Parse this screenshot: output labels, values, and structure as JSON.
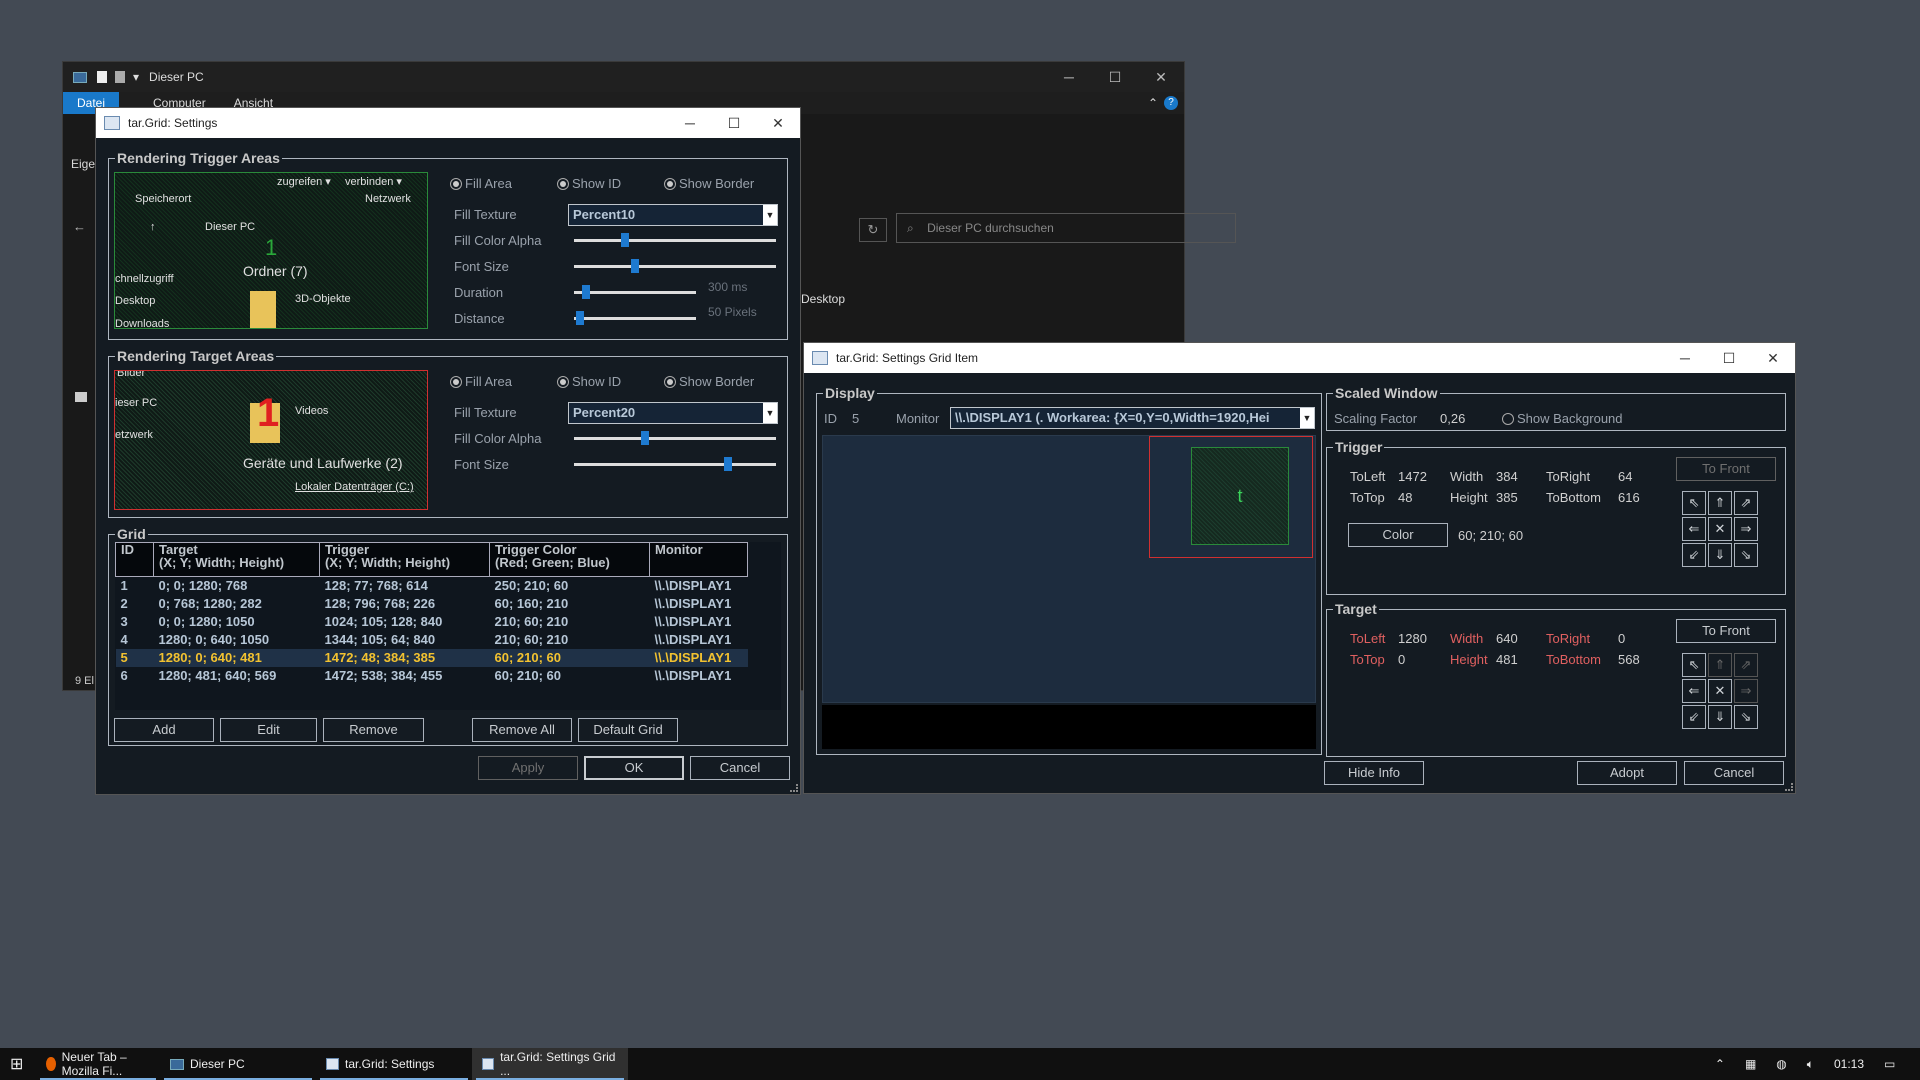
{
  "explorer": {
    "title": "Dieser PC",
    "ribbon_tabs": [
      "Datei",
      "Computer",
      "Ansicht"
    ],
    "search_placeholder": "Dieser PC durchsuchen",
    "side_text": "Eiger",
    "status": "9 El",
    "desktop_label": "Desktop",
    "path_hint": "n"
  },
  "settings": {
    "title": "tar.Grid: Settings",
    "trigger_group": "Rendering Trigger Areas",
    "target_group": "Rendering Target Areas",
    "fill_area": "Fill Area",
    "show_id": "Show ID",
    "show_border": "Show Border",
    "fill_texture_label": "Fill Texture",
    "trigger_texture": "Percent10",
    "target_texture": "Percent20",
    "fill_alpha_label": "Fill Color Alpha",
    "font_size_label": "Font Size",
    "duration_label": "Duration",
    "distance_label": "Distance",
    "duration_value": "300 ms",
    "distance_value": "50 Pixels",
    "trigger_fill_alpha": 0.25,
    "trigger_font_size": 0.3,
    "duration": 0.1,
    "distance": 0.05,
    "target_fill_alpha": 0.35,
    "target_font_size": 0.76,
    "preview_trigger": {
      "zugreifen": "zugreifen ▾",
      "verbinden": "verbinden ▾",
      "speicherort": "Speicherort",
      "netzwerk": "Netzwerk",
      "dieser_pc": "Dieser PC",
      "ordner": "Ordner (7)",
      "schnell": "chnellzugriff",
      "desktop": "Desktop",
      "downloads": "Downloads",
      "objekte": "3D-Objekte",
      "id": "1"
    },
    "preview_target": {
      "bilder": "Bilder",
      "dieser": "ieser PC",
      "netzwerk": "etzwerk",
      "videos": "Videos",
      "geraete": "Geräte und Laufwerke (2)",
      "laufwerk": "Lokaler Datenträger (C:)",
      "id": "1"
    },
    "grid_group": "Grid",
    "columns": [
      {
        "h1": "ID",
        "h2": ""
      },
      {
        "h1": "Target",
        "h2": "(X; Y; Width; Height)"
      },
      {
        "h1": "Trigger",
        "h2": "(X; Y; Width; Height)"
      },
      {
        "h1": "Trigger Color",
        "h2": "(Red; Green; Blue)"
      },
      {
        "h1": "Monitor",
        "h2": ""
      }
    ],
    "rows": [
      [
        "1",
        "0; 0; 1280; 768",
        "128; 77; 768; 614",
        "250; 210; 60",
        "\\\\.\\DISPLAY1"
      ],
      [
        "2",
        "0; 768; 1280; 282",
        "128; 796; 768; 226",
        "60; 160; 210",
        "\\\\.\\DISPLAY1"
      ],
      [
        "3",
        "0; 0; 1280; 1050",
        "1024; 105; 128; 840",
        "210; 60; 210",
        "\\\\.\\DISPLAY1"
      ],
      [
        "4",
        "1280; 0; 640; 1050",
        "1344; 105; 64; 840",
        "210; 60; 210",
        "\\\\.\\DISPLAY1"
      ],
      [
        "5",
        "1280; 0; 640; 481",
        "1472; 48; 384; 385",
        "60; 210; 60",
        "\\\\.\\DISPLAY1"
      ],
      [
        "6",
        "1280; 481; 640; 569",
        "1472; 538; 384; 455",
        "60; 210; 60",
        "\\\\.\\DISPLAY1"
      ]
    ],
    "selected_row": 4,
    "btn_add": "Add",
    "btn_edit": "Edit",
    "btn_remove": "Remove",
    "btn_remove_all": "Remove All",
    "btn_default": "Default Grid",
    "btn_apply": "Apply",
    "btn_ok": "OK",
    "btn_cancel": "Cancel"
  },
  "item": {
    "title": "tar.Grid: Settings Grid Item",
    "display_group": "Display",
    "id_label": "ID",
    "id_value": "5",
    "monitor_label": "Monitor",
    "monitor_value": "\\\\.\\DISPLAY1 (. Workarea: {X=0,Y=0,Width=1920,Hei",
    "scaled_group": "Scaled Window",
    "scaling_label": "Scaling Factor",
    "scaling_value": "0,26",
    "show_bg": "Show Background",
    "trigger_group": "Trigger",
    "trigger": {
      "toleft_l": "ToLeft",
      "toleft": "1472",
      "width_l": "Width",
      "width": "384",
      "toright_l": "ToRight",
      "toright": "64",
      "totop_l": "ToTop",
      "totop": "48",
      "height_l": "Height",
      "height": "385",
      "tobottom_l": "ToBottom",
      "tobottom": "616"
    },
    "to_front": "To Front",
    "color_btn": "Color",
    "color_value": "60; 210; 60",
    "target_group": "Target",
    "target": {
      "toleft_l": "ToLeft",
      "toleft": "1280",
      "width_l": "Width",
      "width": "640",
      "toright_l": "ToRight",
      "toright": "0",
      "totop_l": "ToTop",
      "totop": "0",
      "height_l": "Height",
      "height": "481",
      "tobottom_l": "ToBottom",
      "tobottom": "568"
    },
    "preview_id": "t",
    "btn_hide": "Hide Info",
    "btn_adopt": "Adopt",
    "btn_cancel": "Cancel",
    "arrows": [
      "⇖",
      "⇑",
      "⇗",
      "⇐",
      "✕",
      "⇒",
      "⇙",
      "⇓",
      "⇘"
    ]
  },
  "taskbar": {
    "tasks": [
      "Neuer Tab – Mozilla Fi...",
      "Dieser PC",
      "tar.Grid: Settings",
      "tar.Grid: Settings Grid ..."
    ],
    "time": "01:13"
  },
  "colors": {
    "trigger_border": "#2a8a3a",
    "target_border": "#d03030",
    "selected_text": "#f2c230",
    "red_label": "#e06060"
  }
}
